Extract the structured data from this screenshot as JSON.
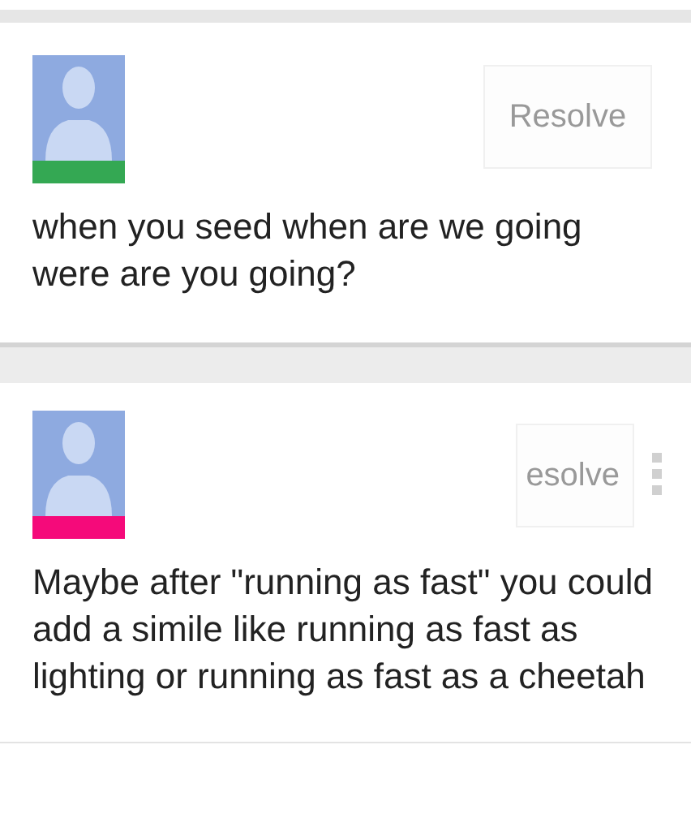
{
  "comments": [
    {
      "color": "#34a853",
      "resolve_label": "Resolve",
      "more_menu": false,
      "text": "when you seed when are we going were are you going?"
    },
    {
      "color": "#f50a7a",
      "resolve_label": "esolve",
      "more_menu": true,
      "text": "Maybe after \"running as fast\" you could add a simile like running as fast as lighting or running as fast as a cheetah"
    }
  ]
}
